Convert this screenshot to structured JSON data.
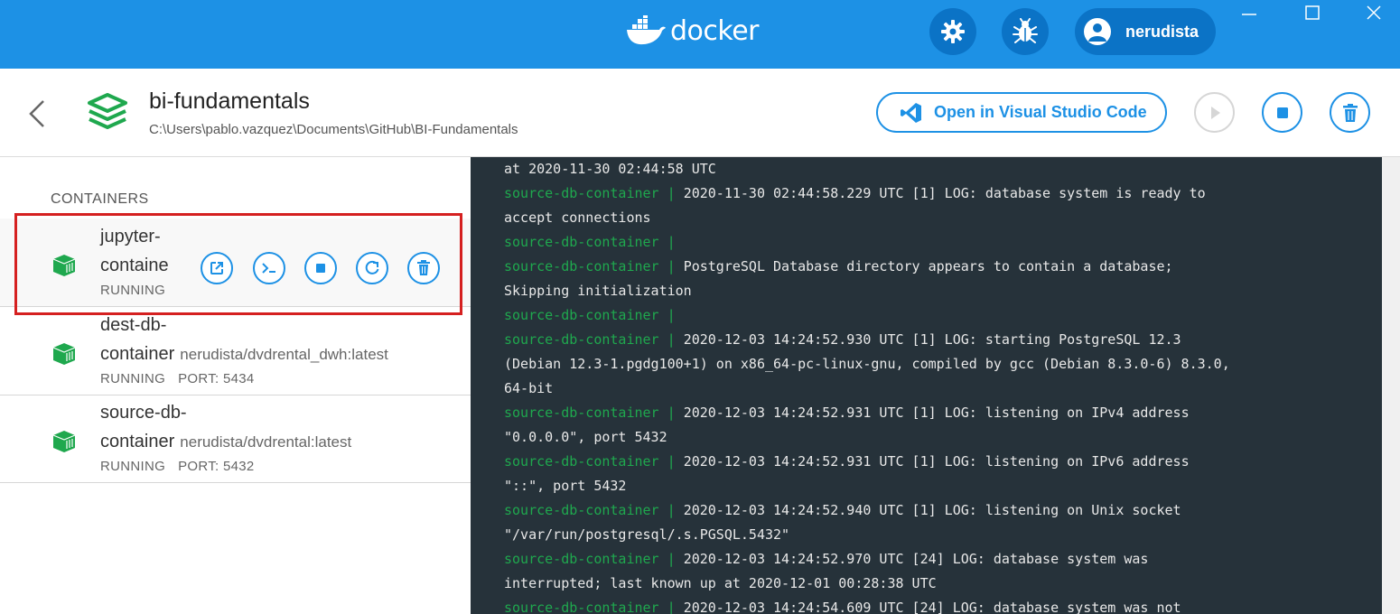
{
  "app": {
    "logo_text": "docker",
    "user_name": "nerudista",
    "colors": {
      "brand_blue": "#1d91e5",
      "dark_button": "#0b73c6",
      "running_green": "#1fa84e",
      "log_bg": "#26323a",
      "highlight_red": "#d52020"
    }
  },
  "header": {
    "title": "bi-fundamentals",
    "path": "C:\\Users\\pablo.vazquez\\Documents\\GitHub\\BI-Fundamentals",
    "vscode_label": "Open in Visual Studio Code"
  },
  "sidebar": {
    "section_label": "CONTAINERS",
    "containers": [
      {
        "name_line1": "jupyter-",
        "name_line2": "containe",
        "image": "",
        "status": "RUNNING",
        "port": ""
      },
      {
        "name_line1": "dest-db-",
        "name_line2": "container",
        "image": "nerudista/dvdrental_dwh:latest",
        "status": "RUNNING",
        "port": "PORT: 5434"
      },
      {
        "name_line1": "source-db-",
        "name_line2": "container",
        "image": "nerudista/dvdrental:latest",
        "status": "RUNNING",
        "port": "PORT: 5432"
      }
    ]
  },
  "logs": {
    "lines": [
      {
        "src": "",
        "text": "at 2020-11-30 02:44:58 UTC"
      },
      {
        "src": "source-db-container | ",
        "text": "2020-11-30 02:44:58.229 UTC [1] LOG: database system is ready to"
      },
      {
        "src": "",
        "text": "accept connections"
      },
      {
        "src": "source-db-container |",
        "text": ""
      },
      {
        "src": "source-db-container | ",
        "text": "PostgreSQL Database directory appears to contain a database;"
      },
      {
        "src": "",
        "text": "Skipping initialization"
      },
      {
        "src": "source-db-container |",
        "text": ""
      },
      {
        "src": "source-db-container | ",
        "text": "2020-12-03 14:24:52.930 UTC [1] LOG: starting PostgreSQL 12.3"
      },
      {
        "src": "",
        "text": "(Debian 12.3-1.pgdg100+1) on x86_64-pc-linux-gnu, compiled by gcc (Debian 8.3.0-6) 8.3.0,"
      },
      {
        "src": "",
        "text": "64-bit"
      },
      {
        "src": "source-db-container | ",
        "text": "2020-12-03 14:24:52.931 UTC [1] LOG: listening on IPv4 address"
      },
      {
        "src": "",
        "text": "\"0.0.0.0\", port 5432"
      },
      {
        "src": "source-db-container | ",
        "text": "2020-12-03 14:24:52.931 UTC [1] LOG: listening on IPv6 address"
      },
      {
        "src": "",
        "text": "\"::\", port 5432"
      },
      {
        "src": "source-db-container | ",
        "text": "2020-12-03 14:24:52.940 UTC [1] LOG: listening on Unix socket"
      },
      {
        "src": "",
        "text": "\"/var/run/postgresql/.s.PGSQL.5432\""
      },
      {
        "src": "source-db-container | ",
        "text": "2020-12-03 14:24:52.970 UTC [24] LOG: database system was"
      },
      {
        "src": "",
        "text": "interrupted; last known up at 2020-12-01 00:28:38 UTC"
      },
      {
        "src": "source-db-container | ",
        "text": "2020-12-03 14:24:54.609 UTC [24] LOG: database system was not"
      }
    ]
  }
}
